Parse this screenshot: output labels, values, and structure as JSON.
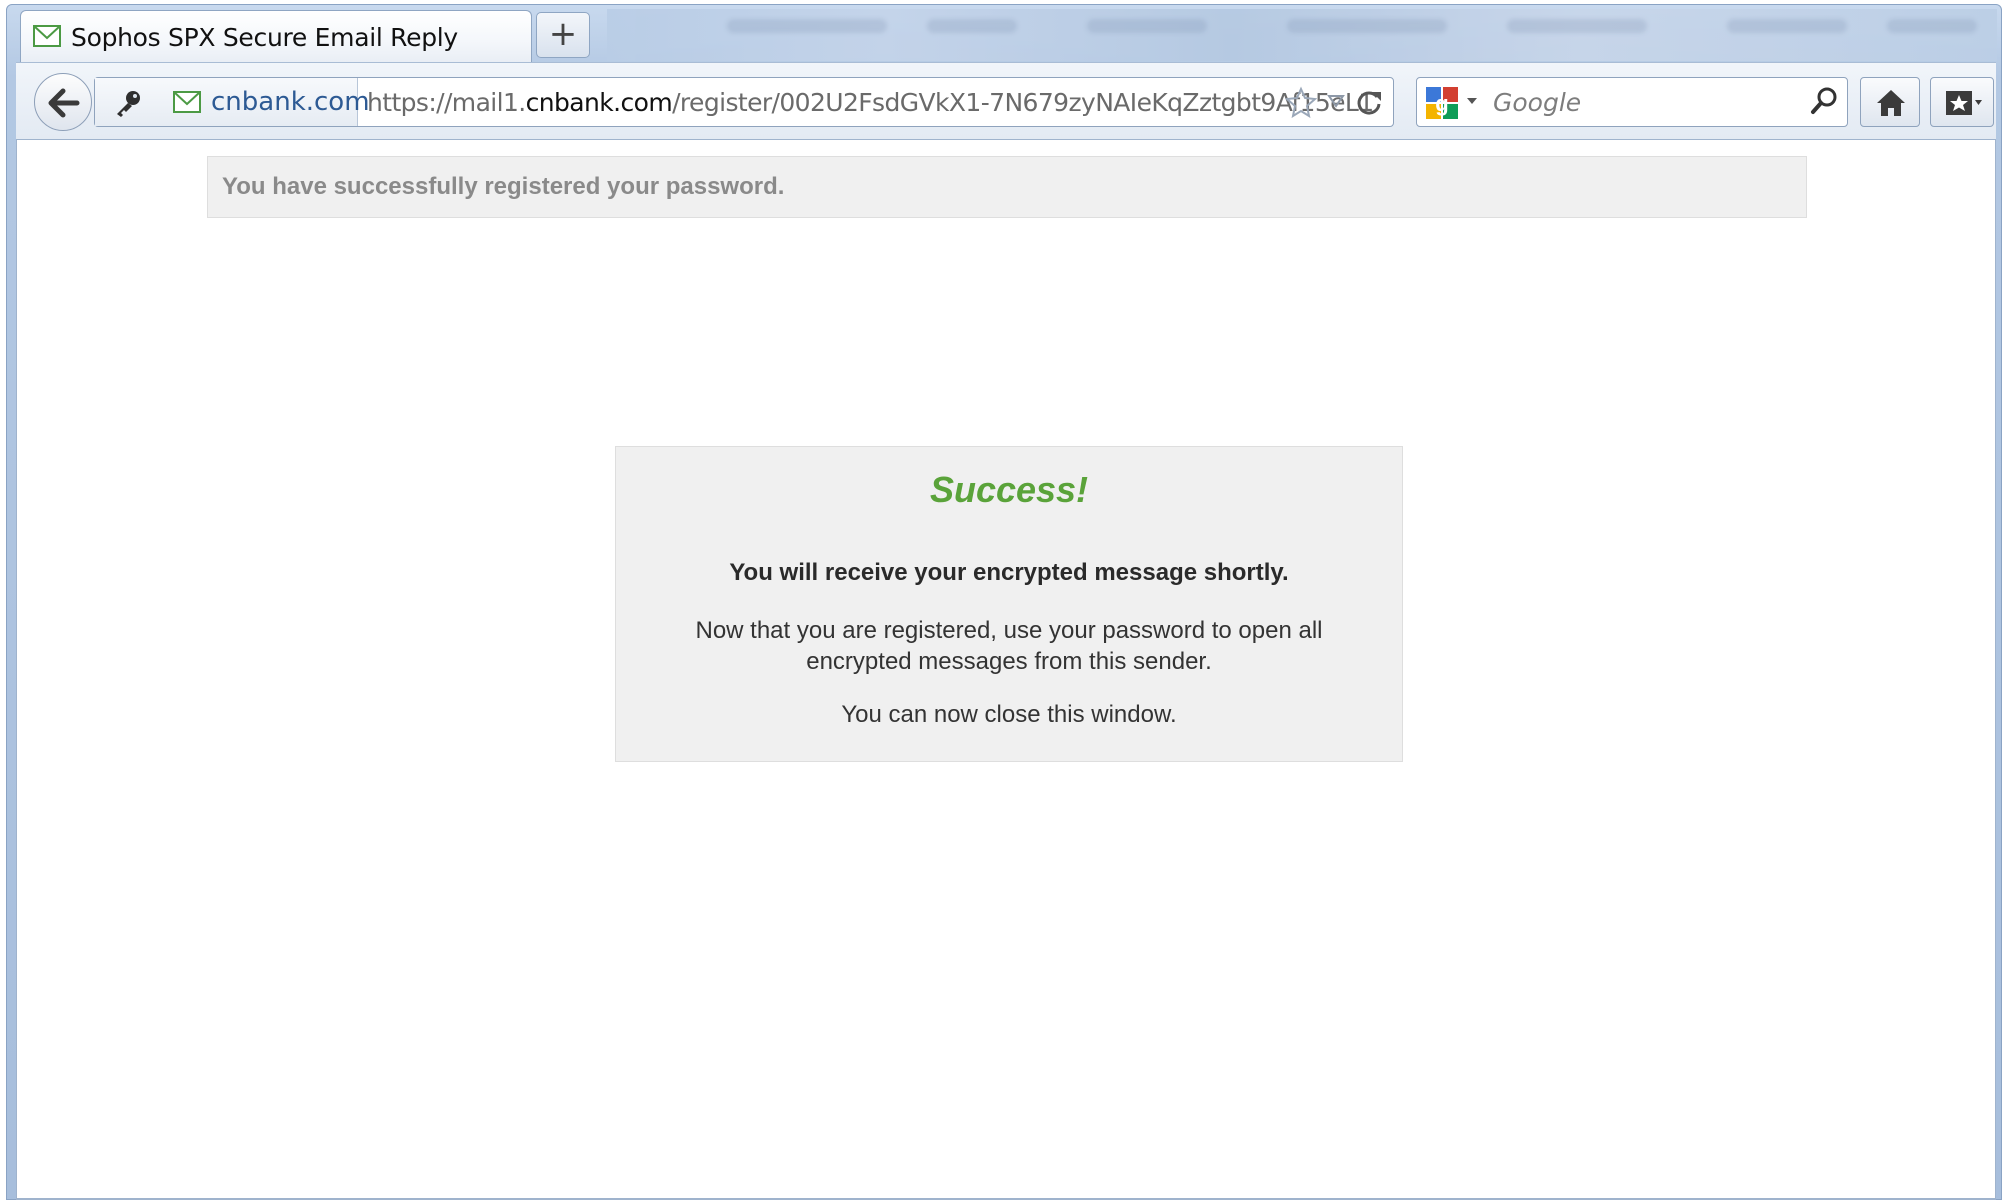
{
  "browser": {
    "tab_title": "Sophos SPX Secure Email Reply",
    "new_tab_label": "+",
    "identity_domain": "cnbank.com",
    "url_prefix": "https://mail1.",
    "url_host": "cnbank.com",
    "url_path": "/register/002U2FsdGVkX1-7N679zyNAIeKqZztgbt9Af15eL1",
    "search_placeholder": "Google",
    "icons": {
      "tab": "mail-icon",
      "back": "back-arrow-icon",
      "identity": "key-icon",
      "site": "mail-icon",
      "bookmark": "star-icon",
      "history": "dropdown-triangle-icon",
      "reload": "reload-icon",
      "search_engine": "google-logo-icon",
      "search": "magnifier-icon",
      "home": "home-icon",
      "bookmarks_menu": "bookmarks-icon"
    }
  },
  "page": {
    "notice": "You have successfully registered your password.",
    "card": {
      "heading": "Success!",
      "lead": "You will receive your encrypted message shortly.",
      "body1": "Now that you are registered, use your password to open all encrypted messages from this sender.",
      "body2": "You can now close this window."
    },
    "colors": {
      "success": "#5aa33a",
      "panel_bg": "#f0f0f0",
      "notice_text": "#8a8a8a"
    }
  }
}
